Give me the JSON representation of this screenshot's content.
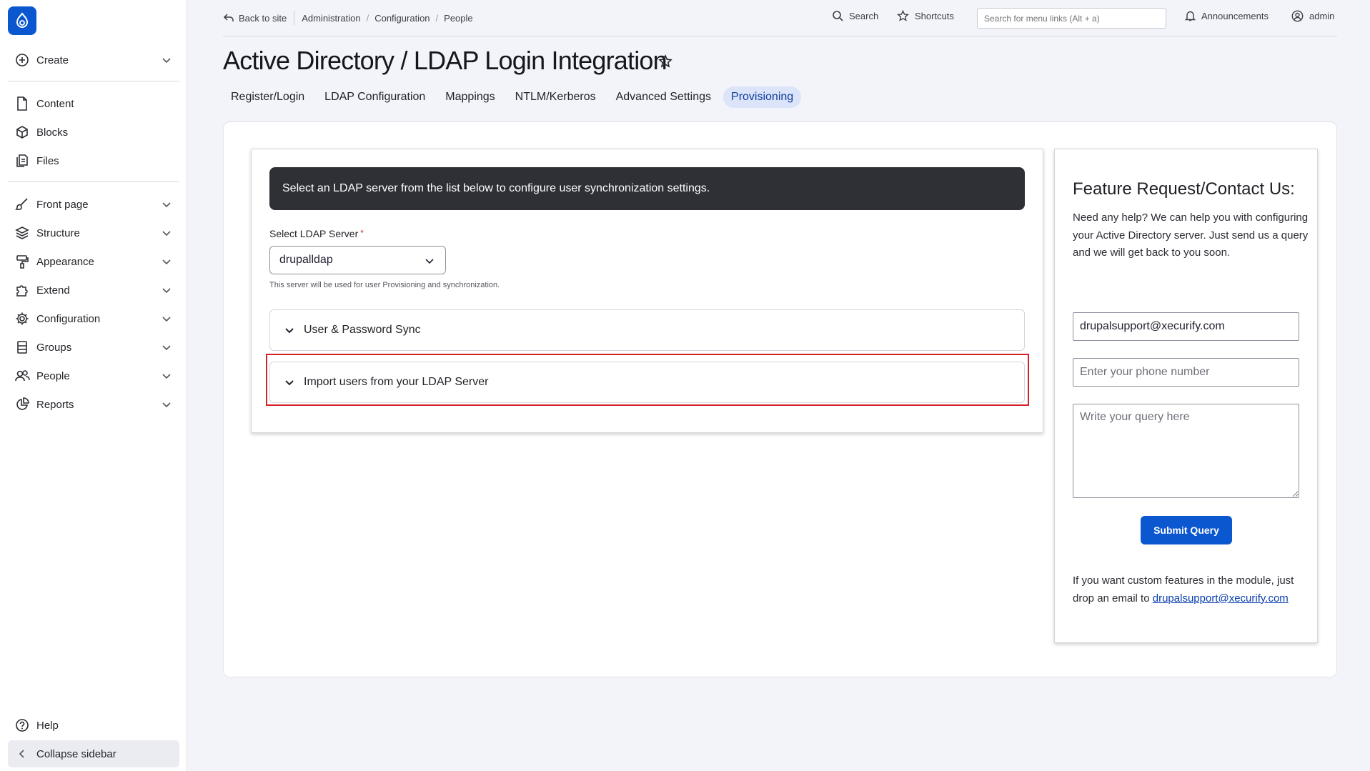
{
  "sidebar": {
    "create": "Create",
    "items": [
      {
        "label": "Content",
        "icon": "file-icon"
      },
      {
        "label": "Blocks",
        "icon": "cube-icon"
      },
      {
        "label": "Files",
        "icon": "files-icon"
      },
      {
        "label": "Front page",
        "icon": "brush-icon"
      },
      {
        "label": "Structure",
        "icon": "layers-icon"
      },
      {
        "label": "Appearance",
        "icon": "paint-roller-icon"
      },
      {
        "label": "Extend",
        "icon": "puzzle-icon"
      },
      {
        "label": "Configuration",
        "icon": "gear-icon"
      },
      {
        "label": "Groups",
        "icon": "group-icon"
      },
      {
        "label": "People",
        "icon": "people-icon"
      },
      {
        "label": "Reports",
        "icon": "pie-chart-icon"
      }
    ],
    "help": "Help",
    "collapse": "Collapse sidebar"
  },
  "topbar": {
    "back": "Back to site",
    "breadcrumbs": [
      "Administration",
      "Configuration",
      "People"
    ],
    "search": "Search",
    "shortcuts": "Shortcuts",
    "menu_search_placeholder": "Search for menu links (Alt + a)",
    "announcements": "Announcements",
    "user": "admin"
  },
  "page": {
    "title": "Active Directory / LDAP Login Integration",
    "tabs": [
      "Register/Login",
      "LDAP Configuration",
      "Mappings",
      "NTLM/Kerberos",
      "Advanced Settings",
      "Provisioning"
    ],
    "active_tab": "Provisioning"
  },
  "provisioning": {
    "banner": "Select an LDAP server from the list below to configure user synchronization settings.",
    "server_label": "Select LDAP Server",
    "required_mark": "*",
    "server_value": "drupalldap",
    "server_desc": "This server will be used for user Provisioning and synchronization.",
    "accordion_1": "User & Password Sync",
    "accordion_2": "Import users from your LDAP Server"
  },
  "contact": {
    "title": "Feature Request/Contact Us:",
    "intro": "Need any help? We can help you with configuring your Active Directory server. Just send us a query and we will get back to you soon.",
    "email_value": "drupalsupport@xecurify.com",
    "phone_placeholder": "Enter your phone number",
    "query_placeholder": "Write your query here",
    "submit": "Submit Query",
    "note": "If you want custom features in the module, just drop an email to",
    "note_link": "drupalsupport@xecurify.com"
  },
  "colors": {
    "accent": "#0b57d0",
    "banner_bg": "#2e3036",
    "active_tab_bg": "#dbe4f8",
    "highlight": "#d3222a"
  }
}
